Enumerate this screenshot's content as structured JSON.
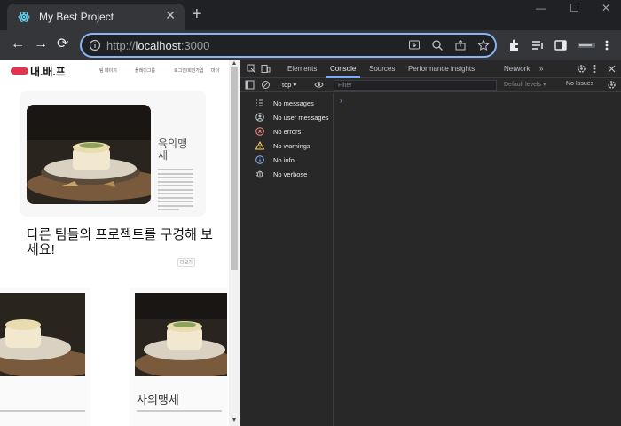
{
  "browser": {
    "tab_title": "My Best Project",
    "tab_close": "✕",
    "new_tab": "+",
    "window_controls": [
      "—",
      "☐",
      "✕"
    ],
    "nav": {
      "back": "←",
      "forward": "→",
      "reload": "⟳"
    },
    "url": {
      "scheme": "http://",
      "host": "localhost",
      "port": ":3000"
    }
  },
  "site": {
    "logo": "내.배.프",
    "nav_links": [
      "팀 페이지",
      "플레이그룹",
      "로그인/회원가입",
      "마이"
    ],
    "hero_card": {
      "title": "육의맹세"
    },
    "headline": "다른 팀들의 프로젝트를 구경해 보세요!",
    "more_button": "더보기",
    "cards": [
      {
        "title": ""
      },
      {
        "title": "사의맹세"
      }
    ]
  },
  "devtools": {
    "tabs": [
      "Elements",
      "Console",
      "Sources",
      "Performance insights",
      "Network"
    ],
    "active_tab": "Console",
    "overflow": "»",
    "context": "top ▾",
    "filter_placeholder": "Filter",
    "levels": "Default levels ▾",
    "issues": "No Issues",
    "prompt": "›",
    "sidebar": [
      {
        "label": "No messages",
        "icon": "list-icon",
        "color": "#bdc1c6"
      },
      {
        "label": "No user messages",
        "icon": "user-icon",
        "color": "#bdc1c6"
      },
      {
        "label": "No errors",
        "icon": "error-icon",
        "color": "#f28b82"
      },
      {
        "label": "No warnings",
        "icon": "warning-icon",
        "color": "#fdd663"
      },
      {
        "label": "No info",
        "icon": "info-icon",
        "color": "#8ab4f8"
      },
      {
        "label": "No verbose",
        "icon": "verbose-icon",
        "color": "#bdc1c6"
      }
    ]
  },
  "colors": {
    "accent": "#8ab4f8",
    "brand": "#e0344f",
    "devtools_bg": "#282828"
  }
}
